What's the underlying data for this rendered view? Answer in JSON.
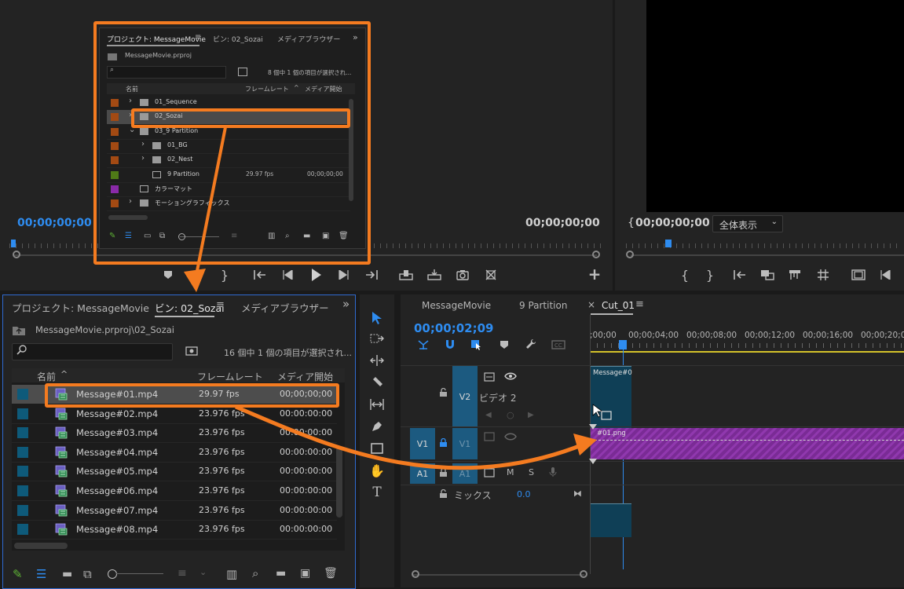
{
  "program": {
    "timecode_left": "00;00;00;00",
    "timecode_right": "00;00;00;00",
    "fit_label": "全体表示"
  },
  "popup": {
    "tabs": [
      "プロジェクト: MessageMovie",
      "ビン: 02_Sozai",
      "メディアブラウザー"
    ],
    "path": "MessageMovie.prproj",
    "status": "8 個中 1 個の項目が選択され...",
    "col_name": "名前",
    "col_framerate": "フレームレート",
    "col_mediastart": "メディア開始",
    "rows": [
      {
        "name": "01_Sequence",
        "fps": "",
        "start": "",
        "color": "#a34a13"
      },
      {
        "name": "02_Sozai",
        "fps": "",
        "start": "",
        "color": "#a34a13"
      },
      {
        "name": "03_9 Partition",
        "fps": "",
        "start": "",
        "color": "#a34a13"
      },
      {
        "name": "01_BG",
        "fps": "",
        "start": "",
        "color": "#a34a13"
      },
      {
        "name": "02_Nest",
        "fps": "",
        "start": "",
        "color": "#a34a13"
      },
      {
        "name": "9 Partition",
        "fps": "29.97 fps",
        "start": "00;00;00;00",
        "color": "#4f7a17"
      },
      {
        "name": "カラーマット",
        "fps": "",
        "start": "",
        "color": "#8a2aa8"
      },
      {
        "name": "モーショングラフィックス",
        "fps": "",
        "start": "",
        "color": "#a34a13"
      }
    ]
  },
  "bin": {
    "tabs": [
      "プロジェクト: MessageMovie",
      "ビン: 02_Sozai",
      "メディアブラウザー"
    ],
    "path": "MessageMovie.prproj\\02_Sozai",
    "status": "16 個中 1 個の項目が選択され...",
    "col_name": "名前",
    "col_framerate": "フレームレート",
    "col_mediastart": "メディア開始",
    "rows": [
      {
        "name": "Message#01.mp4",
        "fps": "29.97 fps",
        "start": "00;00;00;00"
      },
      {
        "name": "Message#02.mp4",
        "fps": "23.976 fps",
        "start": "00:00:00:00"
      },
      {
        "name": "Message#03.mp4",
        "fps": "23.976 fps",
        "start": "00:00:00:00"
      },
      {
        "name": "Message#04.mp4",
        "fps": "23.976 fps",
        "start": "00:00:00:00"
      },
      {
        "name": "Message#05.mp4",
        "fps": "23.976 fps",
        "start": "00:00:00:00"
      },
      {
        "name": "Message#06.mp4",
        "fps": "23.976 fps",
        "start": "00:00:00:00"
      },
      {
        "name": "Message#07.mp4",
        "fps": "23.976 fps",
        "start": "00:00:00:00"
      },
      {
        "name": "Message#08.mp4",
        "fps": "23.976 fps",
        "start": "00:00:00:00"
      }
    ]
  },
  "timeline": {
    "tabs": [
      "MessageMovie",
      "9 Partition",
      "Cut_01"
    ],
    "timecode": "00;00;02;09",
    "ruler": [
      ";00;00",
      "00;00;04;00",
      "00;00;08;00",
      "00;00;12;00",
      "00;00;16;00",
      "00;00;20;00"
    ],
    "v2_label": "V2",
    "v2_name": "ビデオ 2",
    "v1_label": "V1",
    "v1_src": "V1",
    "a1_label": "A1",
    "a1_src": "A1",
    "mute": "M",
    "solo": "S",
    "mix_label": "ミックス",
    "mix_value": "0.0",
    "clip_v2": "Message#0",
    "clip_v1": "#01.png"
  }
}
